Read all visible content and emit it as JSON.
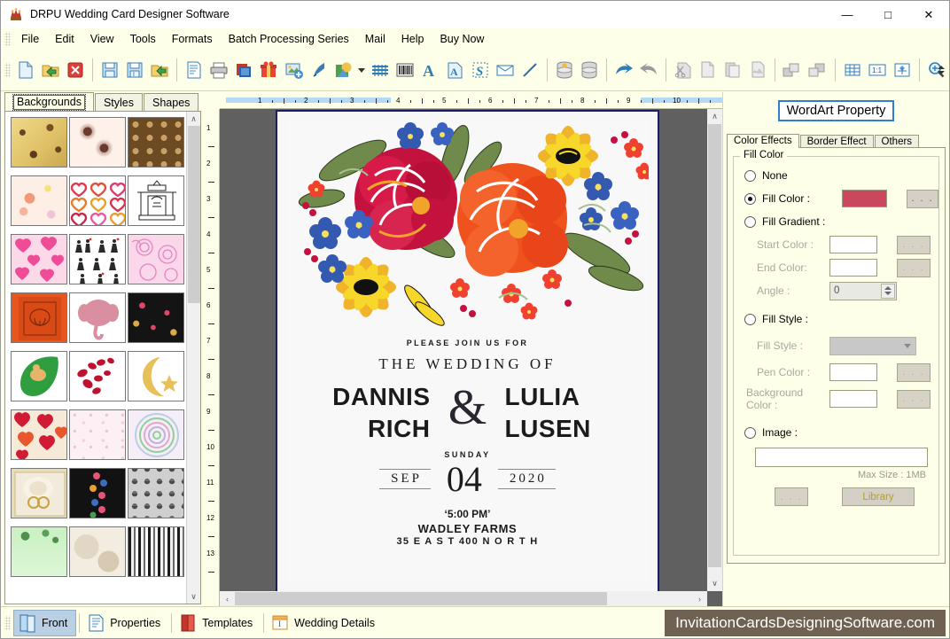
{
  "window": {
    "title": "DRPU Wedding Card Designer Software",
    "icon": "app-icon",
    "minimize": "—",
    "maximize": "□",
    "close": "✕"
  },
  "menu": {
    "items": [
      {
        "label": "File"
      },
      {
        "label": "Edit"
      },
      {
        "label": "View"
      },
      {
        "label": "Tools"
      },
      {
        "label": "Formats"
      },
      {
        "label": "Batch Processing Series"
      },
      {
        "label": "Mail"
      },
      {
        "label": "Help"
      },
      {
        "label": "Buy Now"
      }
    ]
  },
  "toolbar": {
    "groups": [
      [
        "new-document-icon",
        "open-folder-icon",
        "close-document-icon"
      ],
      [
        "save-icon",
        "save-as-icon",
        "export-folder-icon"
      ],
      [
        "page-setup-icon",
        "print-icon",
        "card-layers-icon",
        "gift-icon",
        "insert-image-icon",
        "pen-icon",
        "shape-icon",
        "watermark-icon",
        "barcode-icon",
        "text-icon",
        "wordart-icon",
        "signature-icon",
        "envelope-icon",
        "line-icon"
      ],
      [
        "database-gold-icon",
        "database-icon"
      ],
      [
        "undo-icon",
        "redo-icon"
      ],
      [
        "cut-icon",
        "copy-icon",
        "paste-icon",
        "delete-icon"
      ],
      [
        "bring-front-icon",
        "send-back-icon"
      ],
      [
        "grid-icon",
        "actual-size-icon",
        "fit-page-icon"
      ],
      [
        "zoom-icon"
      ]
    ]
  },
  "left_panel": {
    "tabs": [
      {
        "label": "Backgrounds",
        "active": true
      },
      {
        "label": "Styles",
        "active": false
      },
      {
        "label": "Shapes",
        "active": false
      }
    ],
    "thumbnails": [
      {
        "name": "vintage-gold-floral"
      },
      {
        "name": "paisley-lace"
      },
      {
        "name": "brown-tile-pattern"
      },
      {
        "name": "pastel-blossom"
      },
      {
        "name": "outline-hearts"
      },
      {
        "name": "wedding-mandap-sketch"
      },
      {
        "name": "pink-hearts"
      },
      {
        "name": "bride-groom-silhouettes"
      },
      {
        "name": "pink-swirl-hearts"
      },
      {
        "name": "orange-ganesha"
      },
      {
        "name": "pink-elephant"
      },
      {
        "name": "black-gold-floral"
      },
      {
        "name": "green-leaf-cherub"
      },
      {
        "name": "rose-petals"
      },
      {
        "name": "moon-and-star"
      },
      {
        "name": "red-glitter-hearts"
      },
      {
        "name": "soft-pink-damask"
      },
      {
        "name": "pastel-mandala"
      },
      {
        "name": "cream-rose-rings"
      },
      {
        "name": "dark-floral-band"
      },
      {
        "name": "grey-lace-pattern"
      },
      {
        "name": "green-floral-wash"
      },
      {
        "name": "beige-marble"
      },
      {
        "name": "monochrome-lace-stripes"
      }
    ],
    "scrollbar": {
      "up": "∧",
      "down": "∨"
    }
  },
  "canvas": {
    "ruler_h_labels": [
      "1",
      "2",
      "3",
      "4",
      "5",
      "6",
      "7",
      "8",
      "9",
      "10"
    ],
    "ruler_v_labels": [
      "1",
      "2",
      "3",
      "4",
      "5",
      "6",
      "7",
      "8",
      "9",
      "10",
      "11",
      "12",
      "13"
    ],
    "scroll_up": "∧",
    "scroll_down": "∨",
    "scroll_left": "‹",
    "scroll_right": "›"
  },
  "card": {
    "artwork": "folk-floral-bouquet",
    "join_line": "PLEASE JOIN US FOR",
    "wedding_line": "THE WEDDING OF",
    "bride_name_line1": "DANNIS",
    "bride_name_line2": "RICH",
    "ampersand": "&",
    "groom_name_line1": "LULIA",
    "groom_name_line2": "LUSEN",
    "weekday": "SUNDAY",
    "month": "SEP",
    "day": "04",
    "year": "2020",
    "time": "‘5:00 PM’",
    "venue": "WADLEY FARMS",
    "address": "35  E A S T 400 N O R T H"
  },
  "right_panel": {
    "title": "WordArt Property",
    "tabs": [
      {
        "label": "Color Effects",
        "active": true
      },
      {
        "label": "Border Effect",
        "active": false
      },
      {
        "label": "Others",
        "active": false
      }
    ],
    "fill_color_group": {
      "legend": "Fill Color",
      "none_label": "None",
      "none_selected": false,
      "fill_color_label": "Fill Color :",
      "fill_color_selected": true,
      "fill_color_value": "#c9485b",
      "fill_color_button": ". . .",
      "fill_gradient_label": "Fill Gradient :",
      "fill_gradient_selected": false,
      "start_color_label": "Start Color :",
      "start_color_value": "",
      "start_color_button": ". . .",
      "end_color_label": "End Color:",
      "end_color_value": "",
      "end_color_button": ". . .",
      "angle_label": "Angle :",
      "angle_value": "0",
      "fill_style_radio_label": "Fill Style :",
      "fill_style_selected": false,
      "fill_style_label": "Fill Style :",
      "fill_style_value": "",
      "pen_color_label": "Pen Color :",
      "pen_color_value": "",
      "pen_color_button": ". . .",
      "background_color_label": "Background Color :",
      "background_color_value": "",
      "background_color_button": ". . .",
      "image_label": "Image :",
      "image_selected": false,
      "image_path_value": "",
      "max_size_label": "Max Size : 1MB",
      "browse_button": ". . .",
      "library_button": "Library"
    }
  },
  "status_bar": {
    "items": [
      {
        "label": "Front",
        "icon": "front-card-icon",
        "active": true
      },
      {
        "label": "Properties",
        "icon": "properties-icon",
        "active": false
      },
      {
        "label": "Templates",
        "icon": "templates-icon",
        "active": false
      },
      {
        "label": "Wedding Details",
        "icon": "wedding-details-icon",
        "active": false
      }
    ],
    "brand": "InvitationCardsDesigningSoftware.com",
    "brand_color": "#6f6253"
  }
}
